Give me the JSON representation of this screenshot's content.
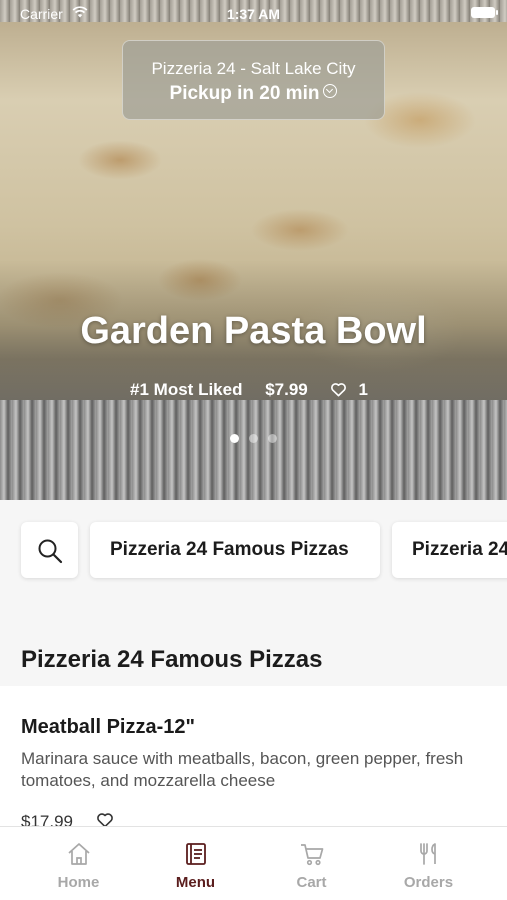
{
  "status_bar": {
    "carrier": "Carrier",
    "time": "1:37 AM"
  },
  "location": {
    "name": "Pizzeria 24 - Salt Lake City",
    "pickup": "Pickup in 20 min"
  },
  "hero": {
    "title": "Garden Pasta Bowl",
    "rank": "#1 Most Liked",
    "price": "$7.99",
    "likes": "1",
    "slide_count": 3,
    "active_slide": 1
  },
  "categories": [
    "Pizzeria 24 Famous Pizzas",
    "Pizzeria 24"
  ],
  "section": {
    "title": "Pizzeria 24 Famous Pizzas"
  },
  "item": {
    "name": "Meatball Pizza-12\"",
    "description": "Marinara sauce with meatballs, bacon, green pepper, fresh tomatoes, and mozzarella cheese",
    "price": "$17.99"
  },
  "tabs": [
    {
      "label": "Home",
      "icon": "home-icon"
    },
    {
      "label": "Menu",
      "icon": "menu-book-icon"
    },
    {
      "label": "Cart",
      "icon": "cart-icon"
    },
    {
      "label": "Orders",
      "icon": "fork-knife-icon"
    }
  ],
  "colors": {
    "accent": "#5a1d1d",
    "tab_inactive": "#a8a8a8"
  }
}
